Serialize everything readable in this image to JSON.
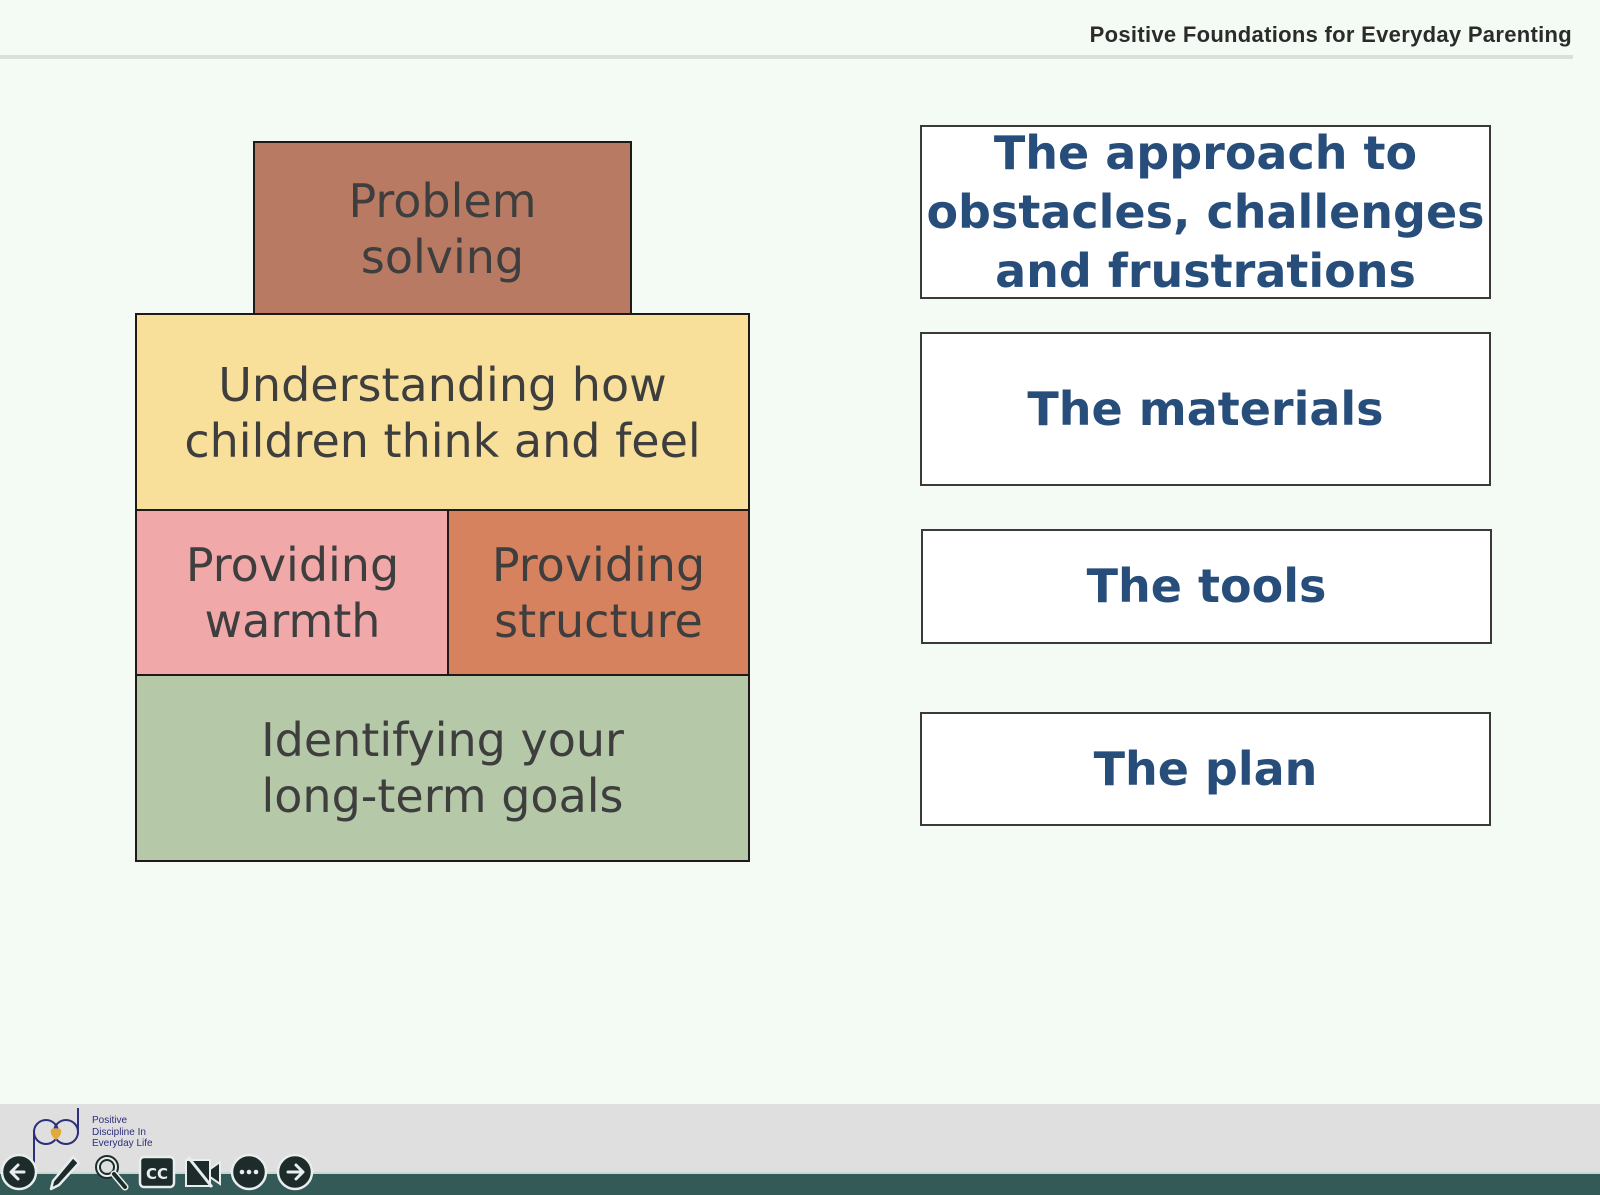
{
  "header": {
    "title": "Positive Foundations for Everyday Parenting"
  },
  "pyramid": {
    "blocks": [
      {
        "label": "Problem\nsolving",
        "color": "#b87a62"
      },
      {
        "label": "Understanding how\nchildren think and feel",
        "color": "#f8e09a"
      },
      {
        "label": "Providing\nwarmth",
        "color": "#f0a8a8"
      },
      {
        "label": "Providing\nstructure",
        "color": "#d7825e"
      },
      {
        "label": "Identifying your\nlong-term goals",
        "color": "#b5c9a8"
      }
    ]
  },
  "cards": [
    {
      "label": "The approach to\nobstacles, challenges\nand frustrations"
    },
    {
      "label": "The materials"
    },
    {
      "label": "The tools"
    },
    {
      "label": "The plan"
    }
  ],
  "footer": {
    "logo_text": "Positive\nDiscipline In\nEveryday Life",
    "toolbar": [
      {
        "name": "previous-button",
        "icon": "arrow-left-icon"
      },
      {
        "name": "annotate-button",
        "icon": "pencil-icon"
      },
      {
        "name": "zoom-button",
        "icon": "magnifier-icon"
      },
      {
        "name": "captions-button",
        "icon": "cc-icon",
        "label": "CC"
      },
      {
        "name": "video-off-button",
        "icon": "video-off-icon"
      },
      {
        "name": "more-button",
        "icon": "ellipsis-icon"
      },
      {
        "name": "next-button",
        "icon": "arrow-right-icon"
      }
    ]
  },
  "colors": {
    "card_text": "#274d7a",
    "bar": "#335a56",
    "background": "#f4fbf4"
  }
}
